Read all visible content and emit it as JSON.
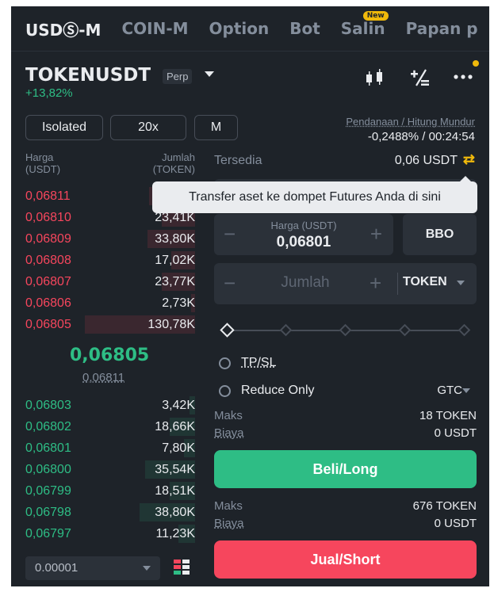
{
  "tabs": [
    {
      "label": "USDⓈ-M",
      "active": true
    },
    {
      "label": "COIN-M",
      "active": false
    },
    {
      "label": "Option",
      "active": false
    },
    {
      "label": "Bot",
      "active": false
    },
    {
      "label": "Salin",
      "active": false,
      "badge": "New"
    },
    {
      "label": "Papan p",
      "active": false
    }
  ],
  "header": {
    "symbol": "TOKENUSDT",
    "contract_type": "Perp",
    "change": "+13,82%",
    "icons": [
      "candlestick-chart-icon",
      "calculator-icon",
      "more-icon"
    ]
  },
  "margin": {
    "mode": "Isolated",
    "leverage": "20x",
    "asset_mode": "M"
  },
  "funding": {
    "label": "Pendanaan / Hitung Mundur",
    "value": "-0,2488% / 00:24:54"
  },
  "orderbook": {
    "price_header": "Harga",
    "price_unit": "(USDT)",
    "qty_header": "Jumlah",
    "qty_unit": "(TOKEN)",
    "asks": [
      {
        "price": "0,06811",
        "qty": "",
        "depth": 0.25
      },
      {
        "price": "0,06810",
        "qty": "23,41K",
        "depth": 0.18
      },
      {
        "price": "0,06809",
        "qty": "33,80K",
        "depth": 0.26
      },
      {
        "price": "0,06808",
        "qty": "17,02K",
        "depth": 0.13
      },
      {
        "price": "0,06807",
        "qty": "23,77K",
        "depth": 0.18
      },
      {
        "price": "0,06806",
        "qty": "2,73K",
        "depth": 0.02
      },
      {
        "price": "0,06805",
        "qty": "130,78K",
        "depth": 0.6
      }
    ],
    "last_price": "0,06805",
    "mark_price": "0,06811",
    "bids": [
      {
        "price": "0,06803",
        "qty": "3,42K",
        "depth": 0.03
      },
      {
        "price": "0,06802",
        "qty": "18,66K",
        "depth": 0.14
      },
      {
        "price": "0,06801",
        "qty": "7,80K",
        "depth": 0.06
      },
      {
        "price": "0,06800",
        "qty": "35,54K",
        "depth": 0.27
      },
      {
        "price": "0,06799",
        "qty": "18,51K",
        "depth": 0.14
      },
      {
        "price": "0,06798",
        "qty": "38,80K",
        "depth": 0.3
      },
      {
        "price": "0,06797",
        "qty": "11,23K",
        "depth": 0.09
      }
    ],
    "precision": "0.00001"
  },
  "order_form": {
    "available_label": "Tersedia",
    "available_value": "0,06 USDT",
    "tooltip": "Transfer aset ke dompet Futures Anda di sini",
    "price_label": "Harga (USDT)",
    "price_value": "0,06801",
    "bbo_label": "BBO",
    "quantity_placeholder": "Jumlah",
    "quantity_unit": "TOKEN",
    "tpsl_label": "TP/SL",
    "reduce_only_label": "Reduce Only",
    "time_in_force": "GTC",
    "buy": {
      "max_label": "Maks",
      "max_value": "18 TOKEN",
      "cost_label": "Biaya",
      "cost_value": "0 USDT",
      "button_label": "Beli/Long"
    },
    "sell": {
      "max_label": "Maks",
      "max_value": "676 TOKEN",
      "cost_label": "Biaya",
      "cost_value": "0 USDT",
      "button_label": "Jual/Short"
    }
  },
  "colors": {
    "background": "#1e2329",
    "buy": "#2ebd85",
    "sell": "#f6465d",
    "accent": "#f0b90b",
    "muted": "#848e9c"
  }
}
